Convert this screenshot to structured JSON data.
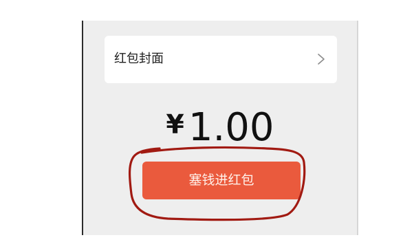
{
  "red_packet": {
    "cover_label": "红包封面",
    "cover_arrow_icon": "chevron-right-icon",
    "currency_symbol": "¥",
    "amount": "1.00",
    "put_money_button": "塞钱进红包"
  },
  "colors": {
    "panel_background": "#eeeeee",
    "button": "#ea5a3d",
    "annotation_circle": "#a11a12"
  }
}
